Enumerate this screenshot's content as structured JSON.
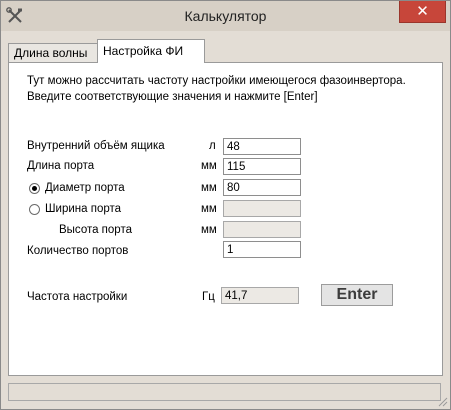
{
  "window": {
    "title": "Калькулятор",
    "close_label": "✕",
    "app_icon": "tools-icon"
  },
  "tabs": [
    {
      "label": "Длина волны",
      "active": false
    },
    {
      "label": "Настройка ФИ",
      "active": true
    }
  ],
  "panel": {
    "intro_line1": "Тут можно рассчитать частоту настройки имеющегося фазоинвертора.",
    "intro_line2": "Введите соответствующие значения и нажмите  [Enter]"
  },
  "form": {
    "volume": {
      "label": "Внутренний объём ящика",
      "unit": "л",
      "value": "48"
    },
    "port_length": {
      "label": "Длина порта",
      "unit": "мм",
      "value": "115"
    },
    "port_diameter": {
      "label": "Диаметр порта",
      "unit": "мм",
      "value": "80",
      "selected": true
    },
    "port_width": {
      "label": "Ширина порта",
      "unit": "мм",
      "value": "",
      "selected": false
    },
    "port_height": {
      "label": "Высота порта",
      "unit": "мм",
      "value": ""
    },
    "port_count": {
      "label": "Количество портов",
      "value": "1"
    },
    "tuning_freq": {
      "label": "Частота настройки",
      "unit": "Гц",
      "value": "41,7"
    }
  },
  "buttons": {
    "enter_label": "Enter"
  },
  "colors": {
    "close_button": "#c7463a",
    "titlebar": "#d7d0c6",
    "panel": "#ffffff"
  }
}
